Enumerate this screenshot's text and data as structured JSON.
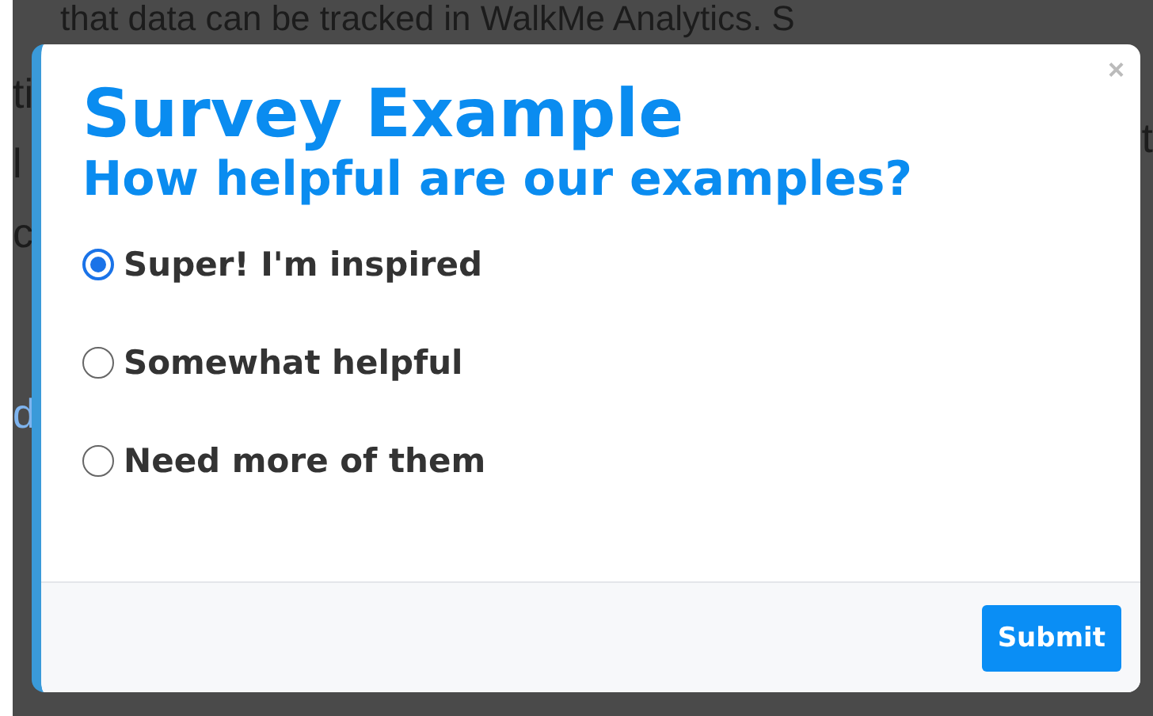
{
  "background_page": {
    "top_line": "that data can be tracked in WalkMe Analytics. S",
    "left_fragments": [
      {
        "text": "ti",
        "kind": "plain"
      },
      {
        "text": "l",
        "kind": "plain"
      },
      {
        "text": "c",
        "kind": "plain"
      },
      {
        "text": "d",
        "kind": "link"
      }
    ],
    "right_fragments": [
      {
        "text": "t"
      }
    ]
  },
  "survey": {
    "title": "Survey Example",
    "question": "How helpful are our examples?",
    "options": [
      {
        "label": "Super! I'm inspired",
        "selected": true
      },
      {
        "label": "Somewhat helpful",
        "selected": false
      },
      {
        "label": "Need more of them",
        "selected": false
      }
    ],
    "close": "×",
    "submit": "Submit"
  }
}
